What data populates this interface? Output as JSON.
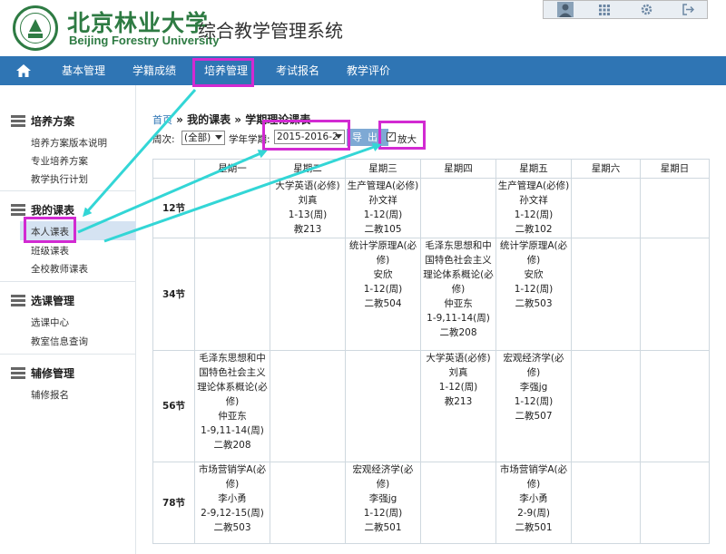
{
  "header": {
    "university_cn": "北京林业大学",
    "university_en": "Beijing Forestry University",
    "system_title": "综合教学管理系统",
    "top_icons": [
      "user-avatar-icon",
      "apps-grid-icon",
      "gear-icon",
      "logout-icon"
    ]
  },
  "nav": {
    "items": [
      {
        "label": "基本管理"
      },
      {
        "label": "学籍成绩"
      },
      {
        "label": "培养管理"
      },
      {
        "label": "考试报名"
      },
      {
        "label": "教学评价"
      }
    ]
  },
  "sidebar": {
    "sections": [
      {
        "title": "培养方案",
        "links": [
          "培养方案版本说明",
          "专业培养方案",
          "教学执行计划"
        ]
      },
      {
        "title": "我的课表",
        "links": [
          "本人课表",
          "班级课表",
          "全校教师课表"
        ]
      },
      {
        "title": "选课管理",
        "links": [
          "选课中心",
          "教室信息查询"
        ]
      },
      {
        "title": "辅修管理",
        "links": [
          "辅修报名"
        ]
      }
    ]
  },
  "breadcrumb": {
    "home": "首页",
    "rest": " » 我的课表 » 学期理论课表"
  },
  "filters": {
    "week_label": "周次:",
    "week_value": "(全部)",
    "term_label": "学年学期:",
    "term_value": "2015-2016-2",
    "export_label": "导出",
    "zoom_label": "放大",
    "zoom_checked": "✓"
  },
  "timetable": {
    "days": [
      "星期一",
      "星期二",
      "星期三",
      "星期四",
      "星期五",
      "星期六",
      "星期日"
    ],
    "periods": [
      {
        "label": "12节",
        "cells": [
          [],
          [
            "大学英语(必修)",
            "刘真",
            "1-13(周)",
            "教213"
          ],
          [
            "生产管理A(必修)",
            "孙文祥",
            "1-12(周)",
            "二教105"
          ],
          [],
          [
            "生产管理A(必修)",
            "孙文祥",
            "1-12(周)",
            "二教102"
          ],
          [],
          []
        ]
      },
      {
        "label": "34节",
        "cells": [
          [],
          [],
          [
            "统计学原理A(必",
            "修)",
            "安欣",
            "1-12(周)",
            "二教504"
          ],
          [
            "毛泽东思想和中",
            "国特色社会主义",
            "理论体系概论(必",
            "修)",
            "仲亚东",
            "1-9,11-14(周)",
            "二教208"
          ],
          [
            "统计学原理A(必",
            "修)",
            "安欣",
            "1-12(周)",
            "二教503"
          ],
          [],
          []
        ]
      },
      {
        "label": "56节",
        "cells": [
          [
            "毛泽东思想和中",
            "国特色社会主义",
            "理论体系概论(必",
            "修)",
            "仲亚东",
            "1-9,11-14(周)",
            "二教208"
          ],
          [],
          [],
          [
            "大学英语(必修)",
            "刘真",
            "1-12(周)",
            "教213"
          ],
          [
            "宏观经济学(必",
            "修)",
            "李强jg",
            "1-12(周)",
            "二教507"
          ],
          [],
          []
        ]
      },
      {
        "label": "78节",
        "cells": [
          [
            "市场营销学A(必",
            "修)",
            "李小勇",
            "2-9,12-15(周)",
            "二教503"
          ],
          [],
          [
            "宏观经济学(必",
            "修)",
            "李强jg",
            "1-12(周)",
            "二教501"
          ],
          [],
          [
            "市场营销学A(必",
            "修)",
            "李小勇",
            "2-9(周)",
            "二教501"
          ],
          [],
          []
        ]
      }
    ]
  },
  "colors": {
    "nav_bg": "#2f75b4",
    "highlight": "#d22ad2",
    "arrow": "#33d6d6",
    "brand_green": "#2e7b43"
  }
}
